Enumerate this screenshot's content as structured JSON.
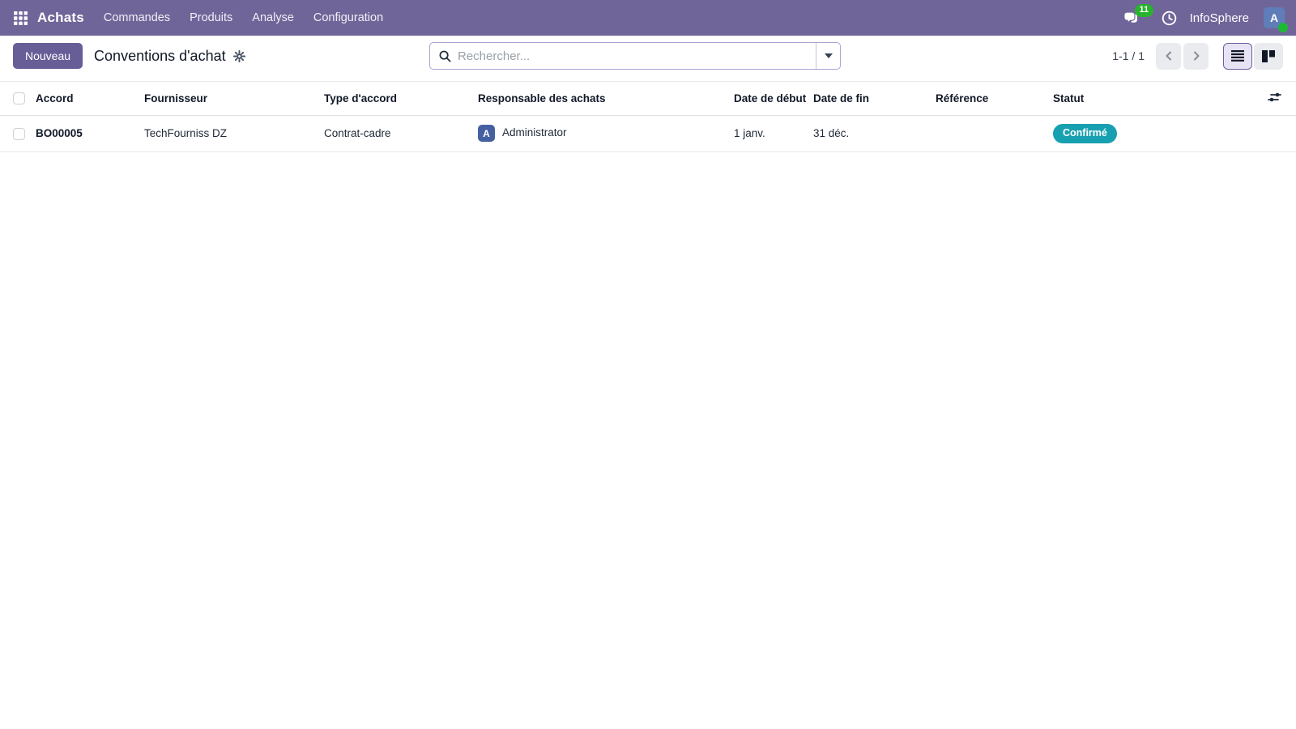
{
  "navbar": {
    "app_name": "Achats",
    "menus": [
      "Commandes",
      "Produits",
      "Analyse",
      "Configuration"
    ],
    "message_count": "11",
    "company": "InfoSphere",
    "avatar_initial": "A"
  },
  "control_panel": {
    "new_button": "Nouveau",
    "title": "Conventions d'achat",
    "search_placeholder": "Rechercher...",
    "pager": "1-1 / 1"
  },
  "table": {
    "columns": [
      "Accord",
      "Fournisseur",
      "Type d'accord",
      "Responsable des achats",
      "Date de début",
      "Date de fin",
      "Référence",
      "Statut"
    ],
    "rows": [
      {
        "accord": "BO00005",
        "fournisseur": "TechFourniss DZ",
        "type_accord": "Contrat-cadre",
        "responsable": "Administrator",
        "responsable_initial": "A",
        "date_debut": "1 janv.",
        "date_fin": "31 déc.",
        "reference": "",
        "statut": "Confirmé"
      }
    ]
  },
  "colors": {
    "navbar_bg": "#706599",
    "primary_button": "#675d97",
    "status_confirmed": "#17a0b0",
    "badge_green": "#28b22d",
    "avatar_blue": "#4460a0"
  }
}
